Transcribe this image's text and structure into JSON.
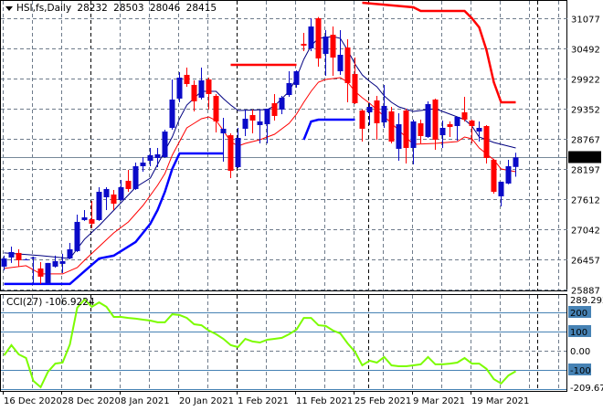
{
  "header": {
    "symbol": "HSI,fs,Daily",
    "open": "28232",
    "high": "28503",
    "low": "28046",
    "close": "28415"
  },
  "cci_header": {
    "name": "CCI(27)",
    "value": "-106.9224"
  },
  "colors": {
    "bull": "#0a0ac8",
    "bear": "#ff0000",
    "upper_ma": "#000080",
    "lower_ma": "#ff0000",
    "lower_step": "#0000ff",
    "upper_step": "#ff0000",
    "cci": "#7cfc00",
    "level": "#4682b4",
    "grid": "#6e7b8b"
  },
  "chart_data": [
    {
      "type": "candlestick",
      "title": "HSI,fs,Daily",
      "ylim": [
        25887,
        31077
      ],
      "y_ticks": [
        "31077",
        "30492",
        "29922",
        "29352",
        "28767",
        "28197",
        "27612",
        "27042",
        "26457",
        "25887"
      ],
      "current_price": "28415",
      "x_labels": [
        "16 Dec 2020",
        "28 Dec 2020",
        "8 Jan 2021",
        "20 Jan 2021",
        "1 Feb 2021",
        "11 Feb 2021",
        "25 Feb 2021",
        "9 Mar 2021",
        "19 Mar 2021"
      ],
      "x_label_index": [
        0,
        8,
        16,
        24,
        32,
        40,
        48,
        56,
        64
      ],
      "ohlc": [
        [
          26325,
          26535,
          26255,
          26482
        ],
        [
          26500,
          26709,
          26395,
          26604
        ],
        [
          26587,
          26657,
          26325,
          26447
        ],
        [
          26465,
          26482,
          26447,
          26465
        ],
        [
          26500,
          26517,
          26011,
          26500
        ],
        [
          26290,
          26412,
          25993,
          26133
        ],
        [
          26011,
          26395,
          26011,
          26395
        ],
        [
          26325,
          26535,
          26307,
          26430
        ],
        [
          26378,
          26570,
          26203,
          26430
        ],
        [
          26482,
          26779,
          26465,
          26657
        ],
        [
          26622,
          27321,
          26604,
          27181
        ],
        [
          27216,
          27408,
          27199,
          27268
        ],
        [
          27233,
          27583,
          27059,
          27146
        ],
        [
          27216,
          27845,
          27199,
          27757
        ],
        [
          27652,
          27845,
          27408,
          27810
        ],
        [
          27705,
          27792,
          27408,
          27530
        ],
        [
          27600,
          27984,
          27583,
          27845
        ],
        [
          27967,
          28177,
          27757,
          27810
        ],
        [
          27810,
          28316,
          27792,
          28246
        ],
        [
          28246,
          28421,
          28142,
          28316
        ],
        [
          28351,
          28596,
          28246,
          28456
        ],
        [
          28404,
          28596,
          28229,
          28474
        ],
        [
          28421,
          28945,
          28404,
          28910
        ],
        [
          28980,
          29906,
          28945,
          29522
        ],
        [
          29540,
          30046,
          29470,
          29941
        ],
        [
          29994,
          30133,
          29767,
          29819
        ],
        [
          29802,
          29889,
          29295,
          29487
        ],
        [
          29557,
          30133,
          29522,
          29889
        ],
        [
          29906,
          29941,
          29330,
          29627
        ],
        [
          29592,
          29627,
          28893,
          29103
        ],
        [
          28875,
          29173,
          28334,
          28963
        ],
        [
          28840,
          28875,
          28019,
          28159
        ],
        [
          28229,
          28980,
          28211,
          28788
        ],
        [
          28963,
          29330,
          28823,
          29155
        ],
        [
          29225,
          29330,
          28875,
          29120
        ],
        [
          29033,
          29330,
          28683,
          29103
        ],
        [
          29050,
          29347,
          28683,
          29347
        ],
        [
          29452,
          29627,
          29120,
          29208
        ],
        [
          29330,
          29592,
          29243,
          29557
        ],
        [
          29609,
          30063,
          29574,
          29837
        ],
        [
          29802,
          30080,
          29749,
          30063
        ],
        [
          30588,
          30797,
          30448,
          30553
        ],
        [
          30500,
          31077,
          30448,
          30920
        ],
        [
          31077,
          31100,
          30151,
          30308
        ],
        [
          30395,
          30850,
          29976,
          30727
        ],
        [
          30762,
          30920,
          29976,
          30325
        ],
        [
          30063,
          30850,
          29994,
          30378
        ],
        [
          30518,
          30675,
          29470,
          29837
        ],
        [
          30011,
          30325,
          29435,
          29452
        ],
        [
          29312,
          29330,
          28718,
          28963
        ],
        [
          29278,
          29452,
          29033,
          29382
        ],
        [
          29505,
          29592,
          28753,
          29068
        ],
        [
          29085,
          29802,
          28980,
          29400
        ],
        [
          29295,
          29382,
          28683,
          28718
        ],
        [
          28579,
          29260,
          28351,
          29050
        ],
        [
          29312,
          29347,
          28299,
          28596
        ],
        [
          28596,
          29138,
          28282,
          29103
        ],
        [
          29068,
          29138,
          28683,
          28823
        ],
        [
          28806,
          29487,
          28788,
          29435
        ],
        [
          29522,
          29540,
          28561,
          28753
        ],
        [
          28840,
          29120,
          28596,
          28980
        ],
        [
          29050,
          29103,
          28806,
          28998
        ],
        [
          29015,
          29190,
          28736,
          29190
        ],
        [
          29278,
          29574,
          29103,
          29138
        ],
        [
          29120,
          29138,
          28683,
          29015
        ],
        [
          28910,
          29103,
          28718,
          28980
        ],
        [
          29015,
          29033,
          28299,
          28404
        ],
        [
          28369,
          28390,
          27722,
          27757
        ],
        [
          27670,
          27950,
          27478,
          27950
        ],
        [
          27915,
          28369,
          27900,
          28246
        ],
        [
          28232,
          28503,
          28046,
          28415
        ]
      ],
      "indicators": [
        {
          "name": "upper-ma",
          "points": [
            [
              0,
              26587
            ],
            [
              5,
              26535
            ],
            [
              9,
              26482
            ],
            [
              11,
              26849
            ],
            [
              13,
              27111
            ],
            [
              16,
              27548
            ],
            [
              18,
              27845
            ],
            [
              20,
              28019
            ],
            [
              22,
              28544
            ],
            [
              23,
              28806
            ],
            [
              24,
              29155
            ],
            [
              25,
              29417
            ],
            [
              27,
              29679
            ],
            [
              29,
              29679
            ],
            [
              30,
              29539
            ],
            [
              31,
              29417
            ],
            [
              32,
              29312
            ],
            [
              36,
              29330
            ],
            [
              37,
              29400
            ],
            [
              38,
              29539
            ],
            [
              39,
              29679
            ],
            [
              40,
              29941
            ],
            [
              41,
              30291
            ],
            [
              42,
              30553
            ],
            [
              43,
              30692
            ],
            [
              45,
              30727
            ],
            [
              46,
              30692
            ],
            [
              47,
              30465
            ],
            [
              48,
              30203
            ],
            [
              49,
              29994
            ],
            [
              50,
              29871
            ],
            [
              51,
              29767
            ],
            [
              52,
              29592
            ],
            [
              53,
              29470
            ],
            [
              54,
              29382
            ],
            [
              56,
              29295
            ],
            [
              58,
              29330
            ],
            [
              59,
              29347
            ],
            [
              60,
              29295
            ],
            [
              62,
              29190
            ],
            [
              63,
              29138
            ],
            [
              64,
              29015
            ],
            [
              65,
              28806
            ],
            [
              67,
              28701
            ],
            [
              70,
              28596
            ]
          ]
        },
        {
          "name": "lower-ma",
          "points": [
            [
              0,
              26290
            ],
            [
              3,
              26343
            ],
            [
              5,
              26185
            ],
            [
              8,
              26185
            ],
            [
              10,
              26307
            ],
            [
              11,
              26447
            ],
            [
              13,
              26709
            ],
            [
              15,
              26971
            ],
            [
              17,
              27181
            ],
            [
              19,
              27495
            ],
            [
              21,
              27880
            ],
            [
              22,
              28107
            ],
            [
              23,
              28456
            ],
            [
              24,
              28718
            ],
            [
              25,
              28980
            ],
            [
              26,
              29068
            ],
            [
              27,
              29155
            ],
            [
              28,
              29190
            ],
            [
              29,
              29120
            ],
            [
              30,
              28928
            ],
            [
              31,
              28718
            ],
            [
              32,
              28631
            ],
            [
              33,
              28683
            ],
            [
              35,
              28753
            ],
            [
              37,
              28858
            ],
            [
              39,
              29068
            ],
            [
              40,
              29243
            ],
            [
              41,
              29470
            ],
            [
              42,
              29679
            ],
            [
              43,
              29854
            ],
            [
              44,
              29906
            ],
            [
              46,
              29941
            ],
            [
              47,
              29854
            ],
            [
              48,
              29679
            ],
            [
              49,
              29557
            ],
            [
              50,
              29452
            ],
            [
              51,
              29330
            ],
            [
              53,
              29068
            ],
            [
              56,
              28666
            ],
            [
              59,
              28683
            ],
            [
              62,
              28718
            ],
            [
              63,
              28806
            ],
            [
              64,
              28771
            ],
            [
              65,
              28596
            ],
            [
              67,
              28369
            ],
            [
              68,
              28194
            ],
            [
              70,
              28142
            ]
          ]
        },
        {
          "name": "lower-step",
          "points": [
            [
              0,
              25993
            ],
            [
              9,
              25993
            ],
            [
              12,
              26360
            ],
            [
              13,
              26482
            ],
            [
              15,
              26535
            ],
            [
              16,
              26622
            ],
            [
              18,
              26797
            ],
            [
              19,
              26971
            ],
            [
              20,
              27146
            ],
            [
              21,
              27408
            ],
            [
              22,
              27757
            ],
            [
              23,
              28194
            ],
            [
              24,
              28491
            ],
            [
              30,
              28491
            ]
          ]
        },
        {
          "name": "lower-step-2",
          "points": [
            [
              41,
              28753
            ],
            [
              42,
              29103
            ],
            [
              43,
              29138
            ],
            [
              48,
              29138
            ]
          ]
        },
        {
          "name": "upper-step",
          "points": [
            [
              31,
              30186
            ],
            [
              40,
              30186
            ]
          ]
        },
        {
          "name": "upper-step-2",
          "points": [
            [
              49,
              31374
            ],
            [
              56,
              31286
            ],
            [
              57,
              31217
            ],
            [
              63,
              31217
            ],
            [
              64,
              31077
            ],
            [
              65,
              30902
            ],
            [
              66,
              30465
            ],
            [
              67,
              29854
            ],
            [
              68,
              29470
            ],
            [
              70,
              29470
            ]
          ]
        }
      ]
    },
    {
      "type": "line",
      "title": "CCI(27)",
      "ylim": [
        -209.673,
        289.2921
      ],
      "y_ticks": [
        "289.2921",
        "200",
        "100",
        "0.00",
        "-100",
        "-209.673"
      ],
      "levels": [
        200,
        100,
        -100,
        -200
      ],
      "values": [
        -24,
        29,
        -19,
        -38,
        -157,
        -190,
        -110,
        -67,
        -62,
        33,
        224,
        267,
        229,
        252,
        229,
        176,
        176,
        171,
        167,
        162,
        157,
        148,
        148,
        190,
        186,
        171,
        138,
        133,
        105,
        86,
        62,
        29,
        19,
        62,
        48,
        43,
        57,
        62,
        67,
        86,
        110,
        171,
        171,
        133,
        129,
        105,
        90,
        38,
        -5,
        -76,
        -52,
        -62,
        -33,
        -76,
        -81,
        -81,
        -76,
        -71,
        -33,
        -71,
        -71,
        -67,
        -62,
        -38,
        -67,
        -67,
        -95,
        -148,
        -171,
        -129,
        -107
      ]
    }
  ]
}
